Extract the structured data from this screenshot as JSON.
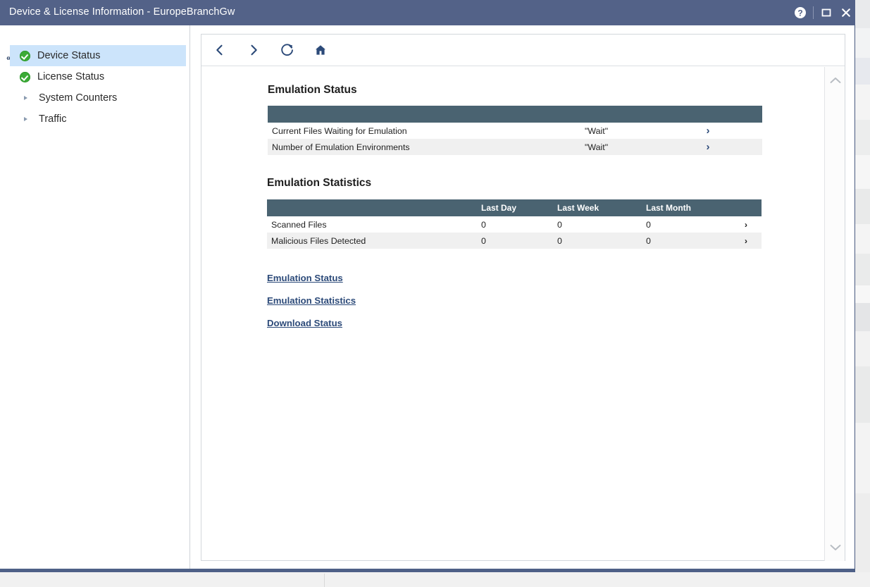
{
  "window": {
    "title": "Device & License Information - EuropeBranchGw",
    "controls": {
      "help": "?",
      "maximize": "□",
      "close": "✕"
    }
  },
  "sidebar": {
    "collapse_label": "«",
    "items": [
      {
        "label": "Device Status",
        "icon": "green-check-icon",
        "selected": true,
        "expandable": false
      },
      {
        "label": "License Status",
        "icon": "green-check-icon",
        "selected": false,
        "expandable": false
      },
      {
        "label": "System Counters",
        "icon": "expand-triangle-icon",
        "selected": false,
        "expandable": true
      },
      {
        "label": "Traffic",
        "icon": "expand-triangle-icon",
        "selected": false,
        "expandable": true
      }
    ]
  },
  "toolbar": {
    "back_label": "‹",
    "forward_label": "›",
    "refresh_label": "⟳",
    "home_label": "⌂"
  },
  "scroll": {
    "up_label": "∧",
    "down_label": "∨"
  },
  "main": {
    "emulation_status": {
      "title": "Emulation Status",
      "header": [
        "",
        ""
      ],
      "rows": [
        {
          "name": "Current Files Waiting for Emulation",
          "value": "\"Wait\"",
          "chevron": "›"
        },
        {
          "name": "Number of Emulation Environments",
          "value": "\"Wait\"",
          "chevron": "›"
        }
      ]
    },
    "emulation_statistics": {
      "title": "Emulation Statistics",
      "columns": [
        "",
        "Last Day",
        "Last Week",
        "Last Month",
        ""
      ],
      "rows": [
        {
          "name": "Scanned Files",
          "last_day": "0",
          "last_week": "0",
          "last_month": "0",
          "chevron": "›"
        },
        {
          "name": "Malicious Files Detected",
          "last_day": "0",
          "last_week": "0",
          "last_month": "0",
          "chevron": "›"
        }
      ]
    },
    "links": [
      {
        "label": "Emulation Status"
      },
      {
        "label": "Emulation Statistics"
      },
      {
        "label": "Download Status"
      }
    ]
  },
  "colors": {
    "titlebar": "#536288",
    "table_header": "#4a6371",
    "selection": "#cce4fb",
    "link": "#2c4a79",
    "status_ok": "#3cab37"
  }
}
